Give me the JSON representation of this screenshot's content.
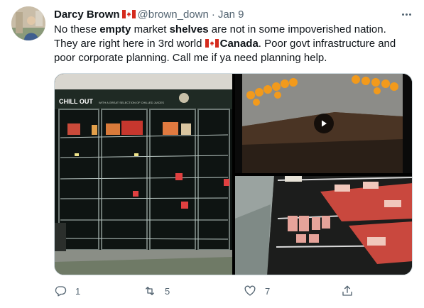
{
  "user": {
    "display_name": "Darcy Brown",
    "handle": "@brown_down",
    "separator": "·",
    "date": "Jan 9",
    "avatar_icon": "profile-photo"
  },
  "tweet": {
    "text_parts": {
      "p1": "No these ",
      "p2": "empty",
      "p3": " market ",
      "p4": "shelves",
      "p5": " are not in some impoverished nation. They are right here in 3rd world ",
      "p6": "Canada",
      "p7": ". Poor govt infrastructure and poor corporate planning. Call me if ya need planning help."
    }
  },
  "media": {
    "photo1_sign": "CHILL OUT",
    "photo1_subsign": "WITH A GREAT SELECTION OF CHILLED JUICES",
    "video_icon": "play-icon"
  },
  "actions": {
    "reply_count": "1",
    "retweet_count": "5",
    "like_count": "7",
    "reply_icon": "reply-icon",
    "retweet_icon": "retweet-icon",
    "like_icon": "heart-icon",
    "share_icon": "share-icon"
  },
  "colors": {
    "text": "#0f1419",
    "secondary": "#536471",
    "border": "#cfd9de",
    "flag_red": "#d52b1e"
  }
}
